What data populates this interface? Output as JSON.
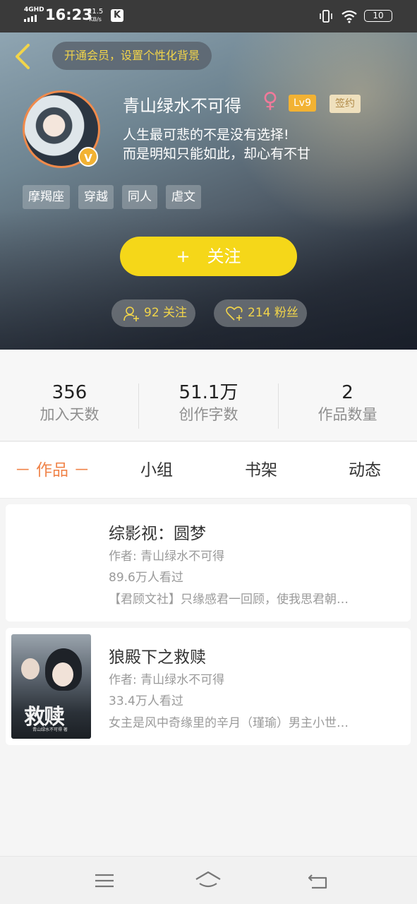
{
  "status_bar": {
    "network": "4GHD",
    "time": "16:23",
    "speed_value": "21.5",
    "speed_unit": "KB/s",
    "app_badge": "K",
    "battery": "10"
  },
  "header": {
    "vip_prompt": "开通会员，设置个性化背景",
    "username": "青山绿水不可得",
    "gender_symbol": "♀",
    "level": "Lv9",
    "signed_badge": "签约",
    "verified_badge": "V",
    "bio_line1": "人生最可悲的不是没有选择!",
    "bio_line2": "而是明知只能如此，却心有不甘",
    "tags": [
      "摩羯座",
      "穿越",
      "同人",
      "虐文"
    ],
    "follow_button": "关注",
    "following_pill": "92 关注",
    "fans_pill": "214 粉丝"
  },
  "stats": [
    {
      "value": "356",
      "label": "加入天数"
    },
    {
      "value": "51.1万",
      "label": "创作字数"
    },
    {
      "value": "2",
      "label": "作品数量"
    }
  ],
  "tabs": [
    {
      "label": "－ 作品 －",
      "active": true
    },
    {
      "label": "小组",
      "active": false
    },
    {
      "label": "书架",
      "active": false
    },
    {
      "label": "动态",
      "active": false
    }
  ],
  "books": [
    {
      "title": "综影视：圆梦",
      "author": "作者: 青山绿水不可得",
      "views": "89.6万人看过",
      "desc": "【君顾文社】只缘感君一回顾，使我思君朝…"
    },
    {
      "title": "狼殿下之救赎",
      "author": "作者: 青山绿水不可得",
      "views": "33.4万人看过",
      "desc": "女主是风中奇缘里的辛月（瑾瑜）男主小世…",
      "cover_title": "救赎",
      "cover_sub": "青山绿水不可得 著"
    }
  ],
  "colors": {
    "accent": "#f0844a",
    "follow_button": "#f5d719",
    "pill_text": "#f2d54a",
    "level_badge": "#f2b233"
  },
  "icons": {
    "back": "chevron-left-icon",
    "follow_plus": "plus-icon",
    "following": "user-add-icon",
    "fans": "heart-add-icon",
    "nav_menu": "menu-icon",
    "nav_home": "home-icon",
    "nav_back": "back-icon"
  }
}
